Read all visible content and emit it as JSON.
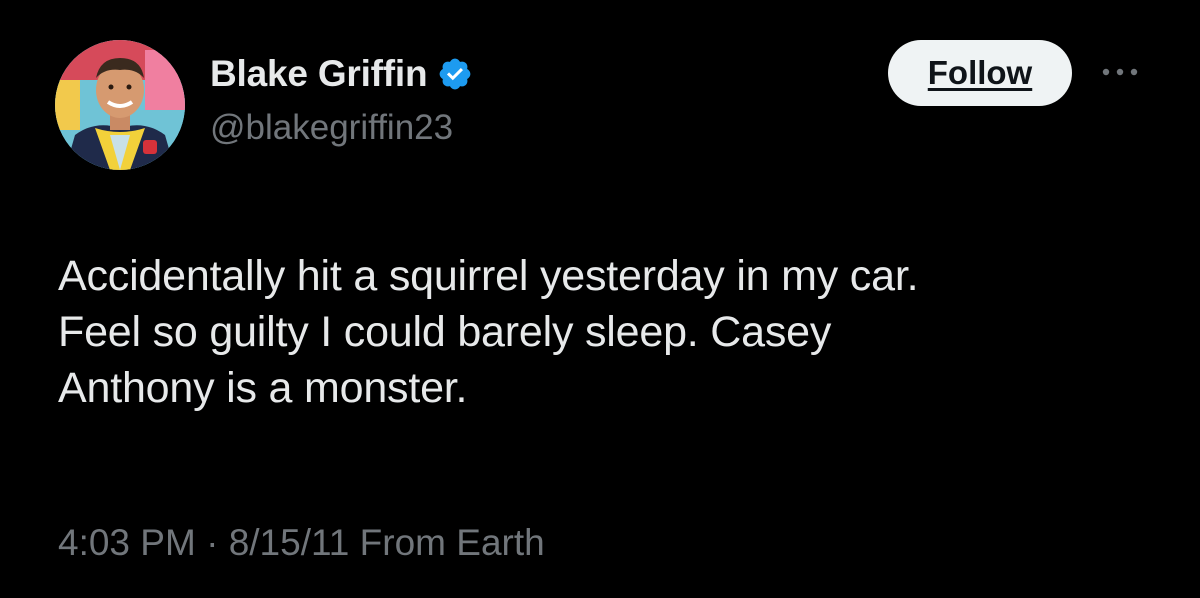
{
  "author": {
    "display_name": "Blake Griffin",
    "handle": "@blakegriffin23",
    "verified": true,
    "avatar_icon": "profile-photo"
  },
  "actions": {
    "follow_label": "Follow",
    "more_icon": "more-dots-icon"
  },
  "tweet": {
    "text": "Accidentally hit a squirrel yesterday in my car.\nFeel so guilty I could barely sleep. Casey\nAnthony is a monster.",
    "time": "4:03 PM",
    "separator": "·",
    "date": "8/15/11",
    "source": "From Earth"
  },
  "colors": {
    "background": "#000000",
    "primary_text": "#e7e9ea",
    "secondary_text": "#71767b",
    "verified_badge": "#1d9bf0",
    "follow_button_bg": "#eff3f4",
    "follow_button_text": "#0f1419"
  }
}
